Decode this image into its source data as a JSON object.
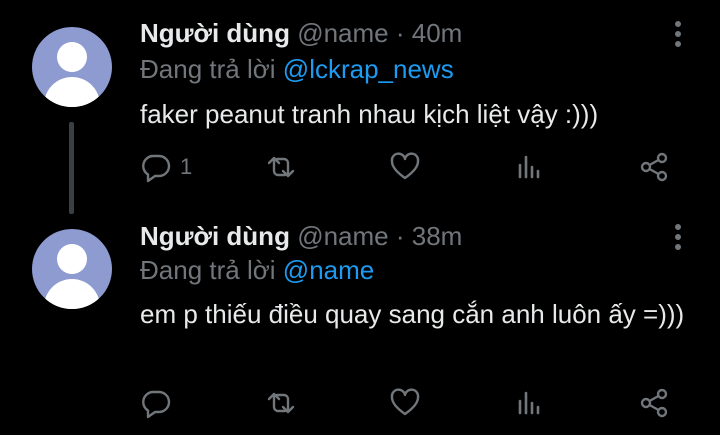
{
  "tweets": [
    {
      "name": "Người dùng",
      "handle": "@name",
      "separator": "·",
      "time": "40m",
      "replying_prefix": "Đang trả lời",
      "replying_to": "@lckrap_news",
      "text": "faker peanut tranh nhau kịch liệt vậy :)))",
      "reply_count": "1"
    },
    {
      "name": "Người dùng",
      "handle": "@name",
      "separator": "·",
      "time": "38m",
      "replying_prefix": "Đang trả lời",
      "replying_to": "@name",
      "text": "em p thiếu điều quay sang cắn anh luôn ấy =)))",
      "reply_count": ""
    }
  ],
  "colors": {
    "background": "#000000",
    "text": "#e7e9ea",
    "muted": "#71767b",
    "accent": "#1d9bf0",
    "avatar": "#8e9bd1"
  },
  "icons": [
    "reply-icon",
    "retweet-icon",
    "like-icon",
    "analytics-icon",
    "share-icon",
    "more-icon"
  ]
}
